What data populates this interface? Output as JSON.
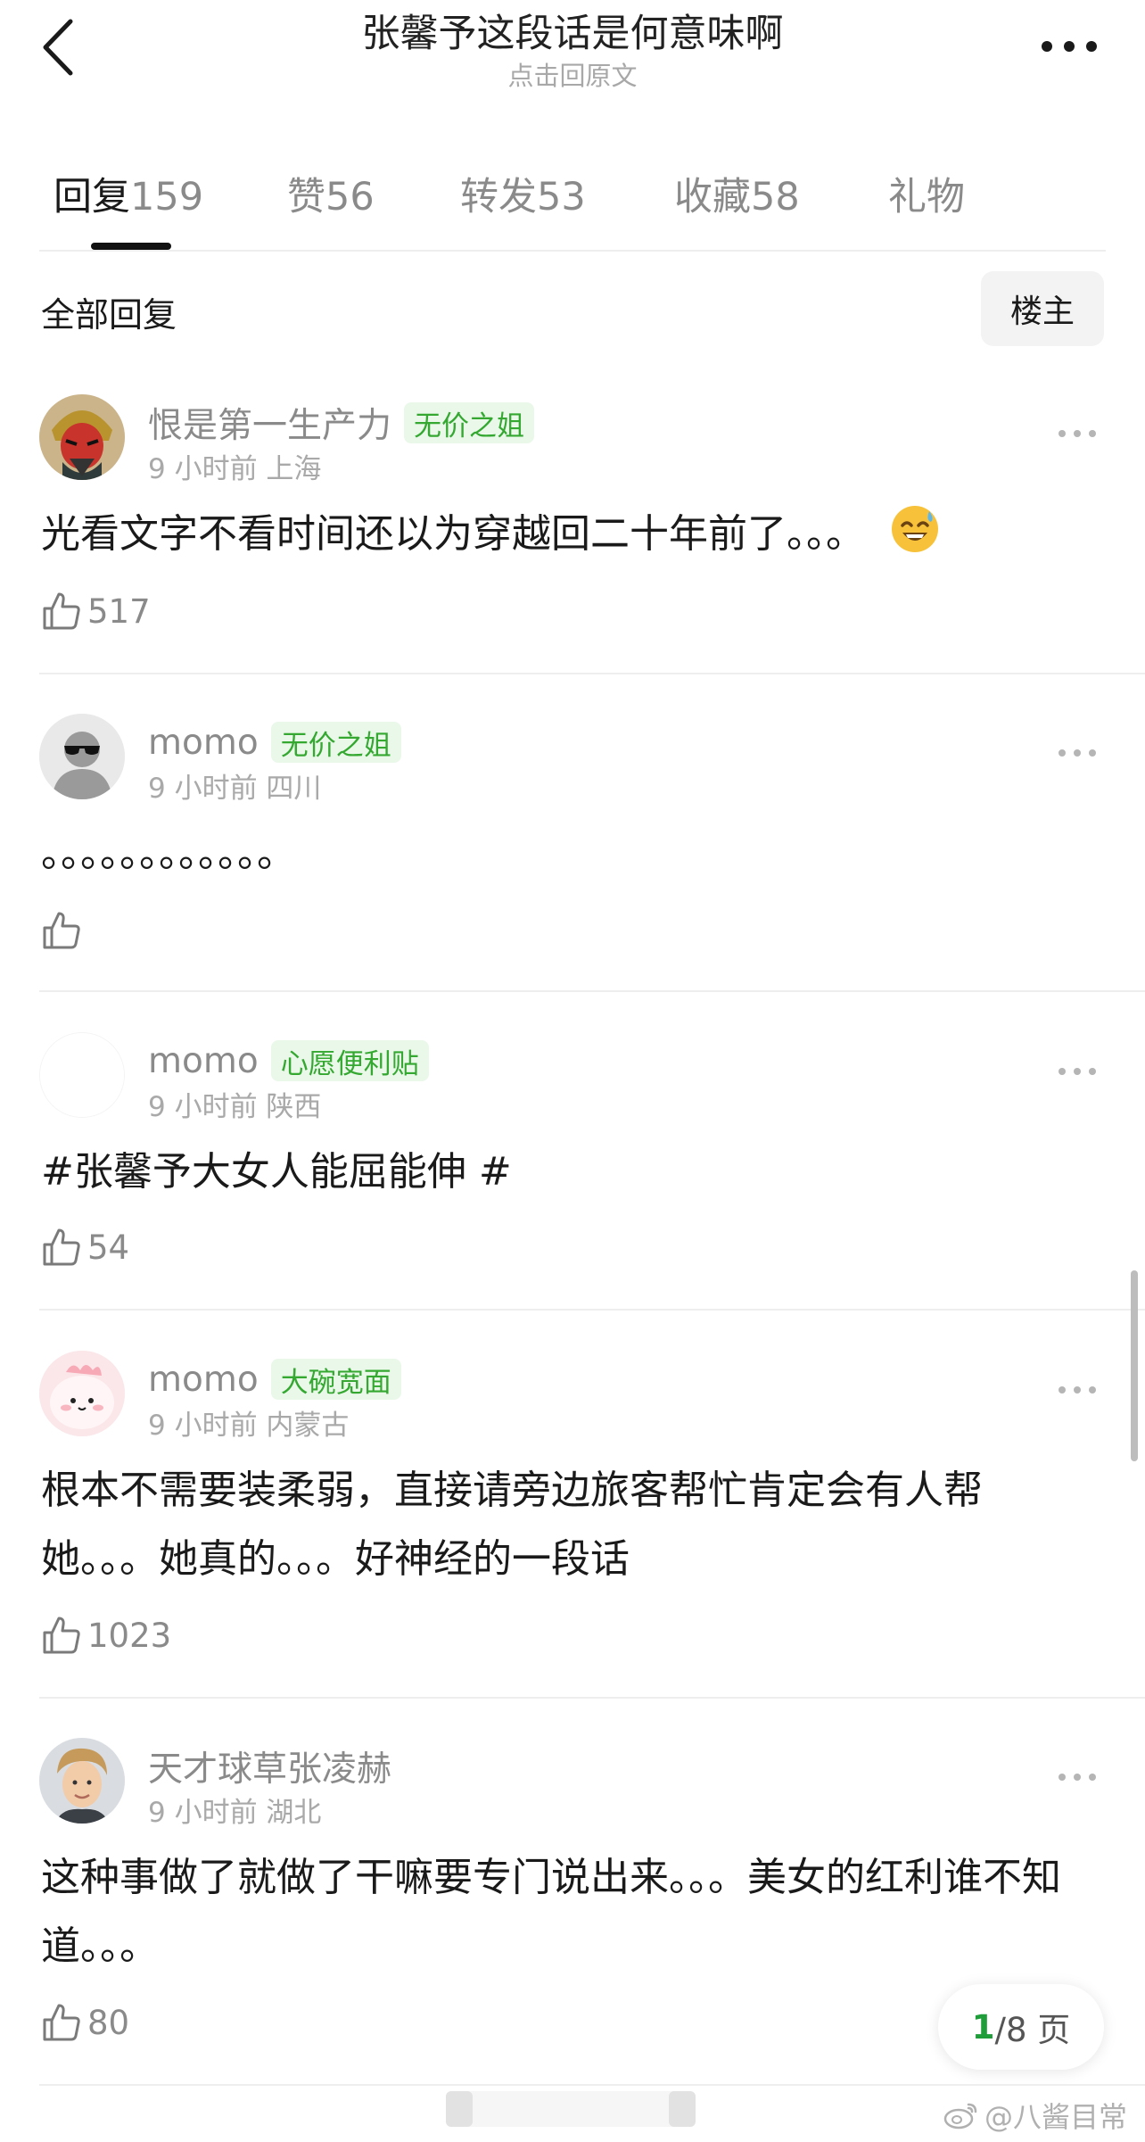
{
  "header": {
    "title": "张馨予这段话是何意味啊",
    "subtitle": "点击回原文"
  },
  "tabs": [
    {
      "label": "回复",
      "count": "159",
      "active": true
    },
    {
      "label": "赞",
      "count": "56"
    },
    {
      "label": "转发",
      "count": "53"
    },
    {
      "label": "收藏",
      "count": "58"
    },
    {
      "label": "礼物",
      "count": ""
    }
  ],
  "filter": {
    "label": "全部回复",
    "owner_button": "楼主"
  },
  "comments": [
    {
      "name": "恨是第一生产力",
      "badge": "无价之姐",
      "meta": "9 小时前 上海",
      "text": "光看文字不看时间还以为穿越回二十年前了。。。",
      "emoji": "sweat-smile-emoji",
      "likes": "517",
      "avatar": "opera-mask-avatar"
    },
    {
      "name": "momo",
      "badge": "无价之姐",
      "meta": "9 小时前 四川",
      "text": "。。。。。。。。。。。。",
      "likes": "",
      "avatar": "sunglasses-avatar"
    },
    {
      "name": "momo",
      "badge": "心愿便利贴",
      "meta": "9 小时前 陕西",
      "text": "#张馨予大女人能屈能伸 #",
      "likes": "54",
      "avatar": "blank-avatar"
    },
    {
      "name": "momo",
      "badge": "大碗宽面",
      "meta": "9 小时前 内蒙古",
      "text": "根本不需要装柔弱，直接请旁边旅客帮忙肯定会有人帮她。。。她真的。。。好神经的一段话",
      "likes": "1023",
      "avatar": "pink-blob-avatar"
    },
    {
      "name": "天才球草张凌赫",
      "badge": "",
      "meta": "9 小时前 湖北",
      "text": "这种事做了就做了干嘛要专门说出来。。。美女的红利谁不知道。。。",
      "likes": "80",
      "avatar": "portrait-avatar"
    }
  ],
  "pager": {
    "current": "1",
    "total_text": "/8 页"
  },
  "watermark": {
    "text": "@八酱目常"
  },
  "colors": {
    "badge_bg": "#eaf8e9",
    "badge_text": "#34a831",
    "pager_current": "#1f9d3a",
    "muted": "#8a8a8a"
  }
}
